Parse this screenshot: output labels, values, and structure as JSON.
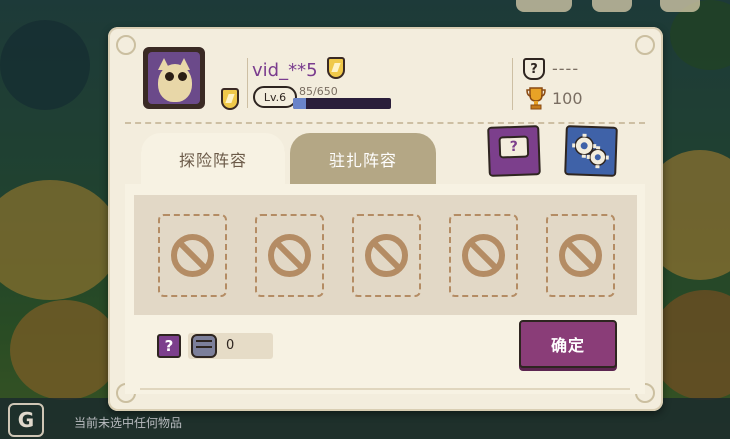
{
  "player": {
    "name": "vid_**5",
    "level": "Lv.6",
    "exp_text": "85/650",
    "exp_fraction": 0.13
  },
  "rank": {
    "badge": "?",
    "value": "----",
    "trophies": "100"
  },
  "tabs": [
    {
      "label": "探险阵容",
      "active": true
    },
    {
      "label": "驻扎阵容",
      "active": false
    }
  ],
  "buttons": {
    "help_glyph": "?",
    "confirm_label": "确定"
  },
  "lineup": {
    "power": "0",
    "help_glyph": "?"
  },
  "bottom_bar": {
    "icon_glyph": "G",
    "message": "当前未选中任何物品"
  },
  "colors": {
    "panel": "#f3eddd",
    "accent_purple": "#8a3d78",
    "accent_blue": "#3f62a8",
    "slot_brown": "#b48c64"
  }
}
